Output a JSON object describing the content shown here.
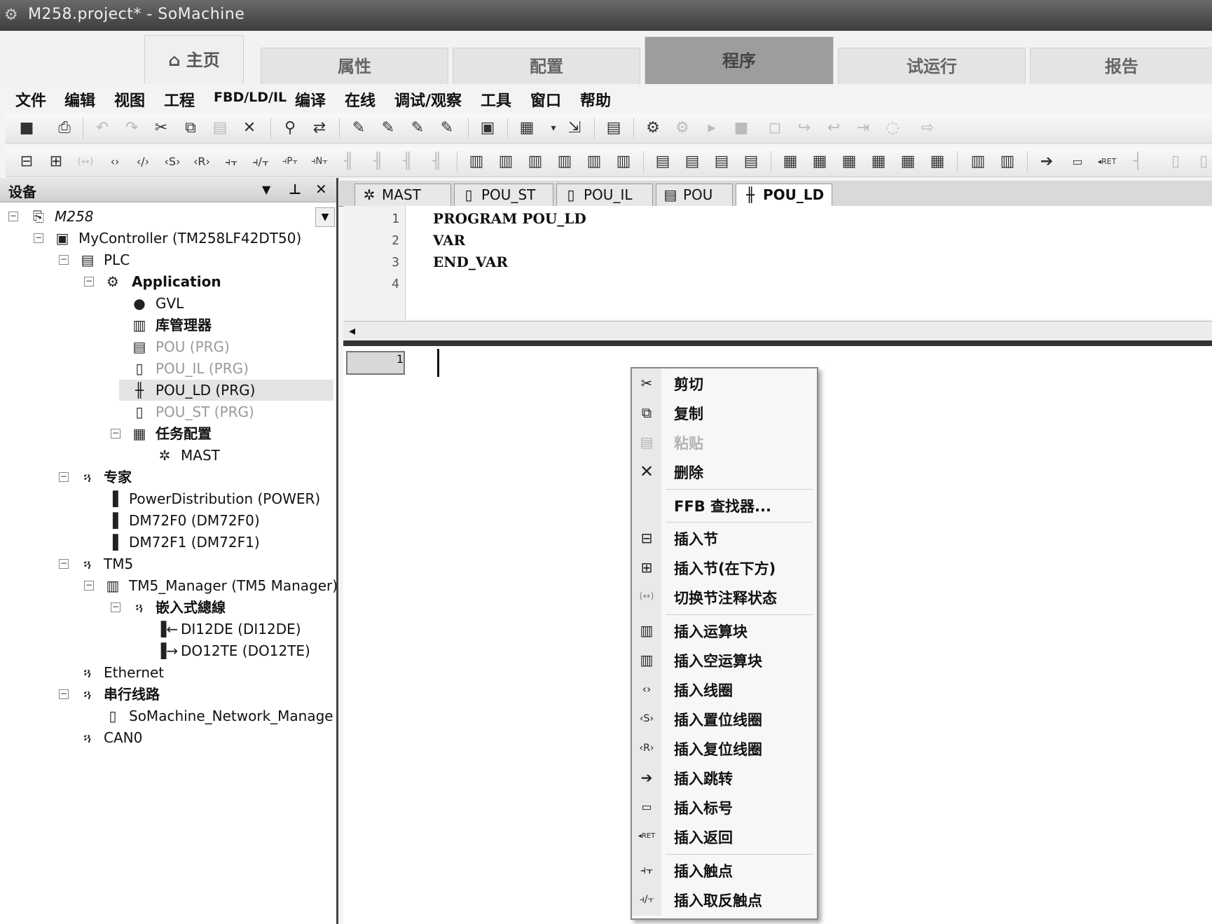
{
  "window": {
    "title": "M258.project* - SoMachine",
    "app_icon": "gear-icon"
  },
  "main_tabs": [
    {
      "label": "主页",
      "icon": "home-icon",
      "active": false
    },
    {
      "label": "属性",
      "active": false
    },
    {
      "label": "配置",
      "active": false
    },
    {
      "label": "程序",
      "active": true
    },
    {
      "label": "试运行",
      "active": false
    },
    {
      "label": "报告",
      "active": false
    }
  ],
  "menu": [
    "文件",
    "编辑",
    "视图",
    "工程",
    "FBD/LD/IL",
    "编译",
    "在线",
    "调试/观察",
    "工具",
    "窗口",
    "帮助"
  ],
  "devices_panel": {
    "title": "设备",
    "tree": [
      {
        "label": "M258",
        "icon": "project-icon",
        "expander": "−"
      },
      {
        "label": "MyController (TM258LF42DT50)",
        "icon": "controller-icon",
        "expander": "−"
      },
      {
        "label": "PLC",
        "icon": "plc-icon",
        "expander": "−"
      },
      {
        "label": "Application",
        "icon": "application-gear-icon",
        "expander": "−"
      },
      {
        "label": "GVL",
        "icon": "globe-icon"
      },
      {
        "label": "库管理器",
        "icon": "library-icon"
      },
      {
        "label": "POU (PRG)",
        "icon": "pou-icon"
      },
      {
        "label": "POU_IL (PRG)",
        "icon": "pou-il-icon"
      },
      {
        "label": "POU_LD (PRG)",
        "icon": "pou-ld-icon"
      },
      {
        "label": "POU_ST (PRG)",
        "icon": "pou-st-icon"
      },
      {
        "label": "任务配置",
        "icon": "task-config-icon",
        "expander": "−"
      },
      {
        "label": "MAST",
        "icon": "task-icon"
      },
      {
        "label": "专家",
        "icon": "plug-icon",
        "expander": "−"
      },
      {
        "label": "PowerDistribution (POWER)",
        "icon": "power-module-icon"
      },
      {
        "label": "DM72F0 (DM72F0)",
        "icon": "io-module-icon"
      },
      {
        "label": "DM72F1 (DM72F1)",
        "icon": "io-module-icon"
      },
      {
        "label": "TM5",
        "icon": "plug-icon",
        "expander": "−"
      },
      {
        "label": "TM5_Manager (TM5 Manager)",
        "icon": "manager-icon",
        "expander": "−"
      },
      {
        "label": "嵌入式總線",
        "icon": "plug-icon",
        "expander": "−"
      },
      {
        "label": "DI12DE (DI12DE)",
        "icon": "digital-input-icon"
      },
      {
        "label": "DO12TE (DO12TE)",
        "icon": "digital-output-icon"
      },
      {
        "label": "Ethernet",
        "icon": "plug-icon"
      },
      {
        "label": "串行线路",
        "icon": "plug-icon",
        "expander": "−"
      },
      {
        "label": "SoMachine_Network_Manager (S",
        "icon": "network-manager-icon"
      },
      {
        "label": "CAN0",
        "icon": "plug-icon"
      }
    ]
  },
  "editor": {
    "tabs": [
      {
        "label": "MAST",
        "icon": "task-icon"
      },
      {
        "label": "POU_ST",
        "icon": "pou-st-icon"
      },
      {
        "label": "POU_IL",
        "icon": "pou-il-icon"
      },
      {
        "label": "POU",
        "icon": "pou-icon"
      },
      {
        "label": "POU_LD",
        "icon": "pou-ld-icon",
        "active": true
      }
    ],
    "declaration": {
      "line_numbers": [
        "1",
        "2",
        "3",
        "4"
      ],
      "lines": [
        "PROGRAM POU_LD",
        "VAR",
        "END_VAR",
        ""
      ]
    },
    "network_number": "1"
  },
  "context_menu": [
    {
      "label": "剪切",
      "icon": "scissors-icon",
      "enabled": true
    },
    {
      "label": "复制",
      "icon": "copy-icon",
      "enabled": true
    },
    {
      "label": "粘贴",
      "icon": "paste-icon",
      "enabled": false
    },
    {
      "label": "删除",
      "icon": "delete-x-icon",
      "enabled": true
    },
    {
      "label": "FFB 查找器...",
      "icon": "",
      "enabled": true
    },
    {
      "label": "插入节",
      "icon": "insert-network-icon",
      "enabled": true
    },
    {
      "label": "插入节(在下方)",
      "icon": "insert-network-below-icon",
      "enabled": true
    },
    {
      "label": "切换节注释状态",
      "icon": "toggle-comment-icon",
      "enabled": true
    },
    {
      "label": "插入运算块",
      "icon": "box-icon",
      "enabled": true
    },
    {
      "label": "插入空运算块",
      "icon": "empty-box-icon",
      "enabled": true
    },
    {
      "label": "插入线圈",
      "icon": "coil-icon",
      "enabled": true
    },
    {
      "label": "插入置位线圈",
      "icon": "set-coil-icon",
      "enabled": true
    },
    {
      "label": "插入复位线圈",
      "icon": "reset-coil-icon",
      "enabled": true
    },
    {
      "label": "插入跳转",
      "icon": "jump-arrow-icon",
      "enabled": true
    },
    {
      "label": "插入标号",
      "icon": "label-icon",
      "enabled": true
    },
    {
      "label": "插入返回",
      "icon": "return-icon",
      "enabled": true
    },
    {
      "label": "插入触点",
      "icon": "contact-icon",
      "enabled": true
    },
    {
      "label": "插入取反触点",
      "icon": "negated-contact-icon",
      "enabled": true
    }
  ]
}
